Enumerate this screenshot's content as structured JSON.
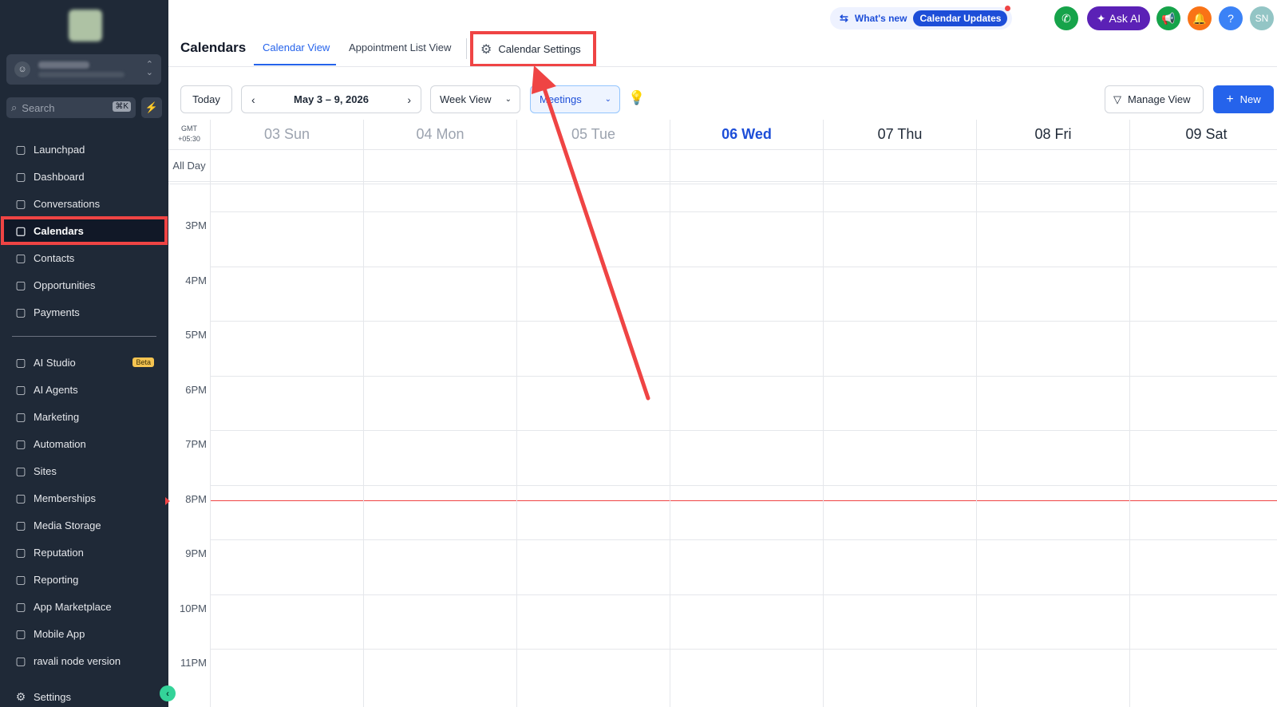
{
  "sidebar": {
    "search_placeholder": "Search",
    "search_shortcut": "⌘K",
    "items": [
      {
        "label": "Launchpad",
        "icon": "launchpad-icon"
      },
      {
        "label": "Dashboard",
        "icon": "dashboard-icon"
      },
      {
        "label": "Conversations",
        "icon": "chat-icon"
      },
      {
        "label": "Calendars",
        "icon": "calendar-icon"
      },
      {
        "label": "Contacts",
        "icon": "contacts-icon"
      },
      {
        "label": "Opportunities",
        "icon": "opportunities-icon"
      },
      {
        "label": "Payments",
        "icon": "payments-icon"
      }
    ],
    "items2": [
      {
        "label": "AI Studio",
        "icon": "ai-studio-icon",
        "badge": "Beta"
      },
      {
        "label": "AI Agents",
        "icon": "sparkle-icon"
      },
      {
        "label": "Marketing",
        "icon": "send-icon"
      },
      {
        "label": "Automation",
        "icon": "automation-icon"
      },
      {
        "label": "Sites",
        "icon": "sites-icon"
      },
      {
        "label": "Memberships",
        "icon": "membership-icon"
      },
      {
        "label": "Media Storage",
        "icon": "image-icon"
      },
      {
        "label": "Reputation",
        "icon": "star-icon"
      },
      {
        "label": "Reporting",
        "icon": "chart-icon"
      },
      {
        "label": "App Marketplace",
        "icon": "grid-icon"
      },
      {
        "label": "Mobile App",
        "icon": "mobile-icon"
      },
      {
        "label": "ravali node version",
        "icon": "node-icon"
      }
    ],
    "settings_label": "Settings"
  },
  "topbar": {
    "whats_new": "What's new",
    "calendar_updates": "Calendar Updates",
    "ask_ai": "Ask AI",
    "help": "?",
    "user_initials": "SN"
  },
  "header": {
    "title": "Calendars",
    "tabs": [
      "Calendar View",
      "Appointment List View"
    ],
    "settings_tab": "Calendar Settings"
  },
  "toolbar": {
    "today": "Today",
    "date_range": "May 3 – 9, 2026",
    "view": "Week View",
    "calendar_filter": "Meetings",
    "manage_view": "Manage View",
    "new": "New"
  },
  "calendar": {
    "timezone_line1": "GMT",
    "timezone_line2": "+05:30",
    "all_day": "All Day",
    "days": [
      "03 Sun",
      "04 Mon",
      "05 Tue",
      "06 Wed",
      "07 Thu",
      "08 Fri",
      "09 Sat"
    ],
    "today_index": 3,
    "hours": [
      "3PM",
      "4PM",
      "5PM",
      "6PM",
      "7PM",
      "8PM",
      "9PM",
      "10PM",
      "11PM"
    ]
  },
  "colors": {
    "sidebar_bg": "#1f2937",
    "accent": "#2563eb",
    "highlight": "#ef4444"
  }
}
